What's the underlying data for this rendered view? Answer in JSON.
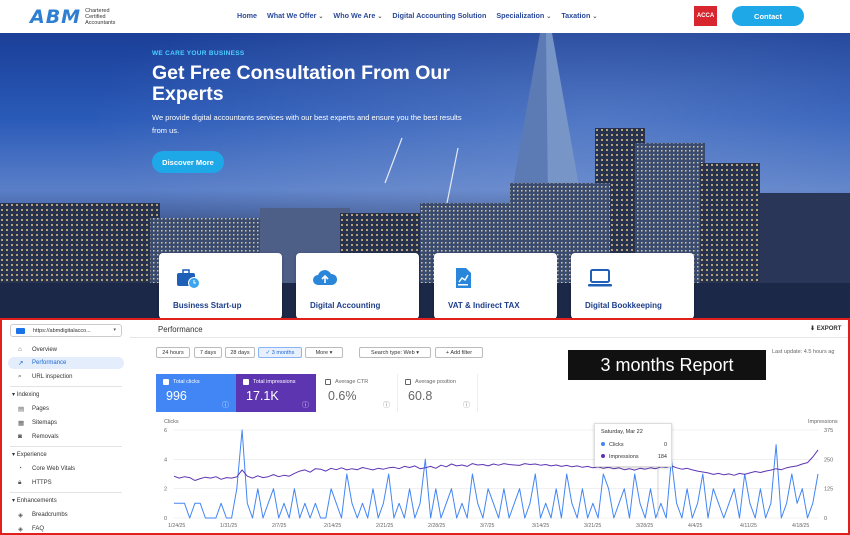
{
  "header": {
    "logo_mark": "ABM",
    "logo_sub": "Chartered Certified Accountants",
    "nav": [
      {
        "label": "Home",
        "dropdown": false
      },
      {
        "label": "What We Offer",
        "dropdown": true
      },
      {
        "label": "Who We Are",
        "dropdown": true
      },
      {
        "label": "Digital Accounting Solution",
        "dropdown": false
      },
      {
        "label": "Specialization",
        "dropdown": true
      },
      {
        "label": "Taxation",
        "dropdown": true
      }
    ],
    "acca_badge": "ACCA",
    "contact_label": "Contact"
  },
  "hero": {
    "eyebrow": "WE CARE YOUR BUSINESS",
    "title": "Get Free Consultation From Our Experts",
    "description": "We provide digital accountants services with our best experts and ensure you the best results from us.",
    "cta_label": "Discover More"
  },
  "services": [
    {
      "label": "Business Start-up",
      "icon": "briefcase-clock-icon"
    },
    {
      "label": "Digital Accounting",
      "icon": "cloud-upload-icon"
    },
    {
      "label": "VAT & Indirect TAX",
      "icon": "document-chart-icon"
    },
    {
      "label": "Digital Bookkeeping",
      "icon": "laptop-icon"
    }
  ],
  "console": {
    "property": "https://abmdigitalacco...",
    "title": "Performance",
    "export_label": "EXPORT",
    "sidebar": {
      "overview": "Overview",
      "performance": "Performance",
      "url_inspection": "URL inspection",
      "indexing": "Indexing",
      "pages": "Pages",
      "sitemaps": "Sitemaps",
      "removals": "Removals",
      "experience": "Experience",
      "core_web_vitals": "Core Web Vitals",
      "https": "HTTPS",
      "enhancements": "Enhancements",
      "breadcrumbs": "Breadcrumbs",
      "faq": "FAQ"
    },
    "filters": {
      "d24h": "24 hours",
      "d7": "7 days",
      "d28": "28 days",
      "m3": "✓  3 months",
      "more": "More ▾",
      "search_type": "Search type: Web ▾",
      "add_filter": "+  Add filter"
    },
    "last_update": "Last update: 4.5 hours ag",
    "report_label": "3 months Report",
    "metrics": {
      "clicks_label": "Total clicks",
      "clicks_value": "996",
      "impr_label": "Total impressions",
      "impr_value": "17.1K",
      "ctr_label": "Average CTR",
      "ctr_value": "0.6%",
      "pos_label": "Average position",
      "pos_value": "60.8"
    },
    "tooltip": {
      "date": "Saturday, Mar 22",
      "clicks_label": "Clicks",
      "clicks_value": "0",
      "impr_label": "Impressions",
      "impr_value": "184"
    },
    "colors": {
      "clicks": "#4285f4",
      "impressions": "#5e35b1"
    }
  },
  "chart_data": {
    "type": "line",
    "ylabel_left": "Clicks",
    "ylabel_right": "Impressions",
    "y_left_ticks": [
      "6",
      "4",
      "2",
      "0"
    ],
    "y_right_ticks": [
      "375",
      "250",
      "125",
      "0"
    ],
    "ylim_left": [
      0,
      6
    ],
    "ylim_right": [
      0,
      375
    ],
    "x_ticks": [
      "1/24/25",
      "1/31/25",
      "2/7/25",
      "2/14/25",
      "2/21/25",
      "2/28/25",
      "3/7/25",
      "3/14/25",
      "3/21/25",
      "3/28/25",
      "4/4/25",
      "4/11/25",
      "4/18/25"
    ],
    "series": [
      {
        "name": "Clicks",
        "values": [
          1,
          1,
          1,
          0,
          1,
          1,
          0,
          0,
          0,
          1,
          0,
          0,
          2,
          6,
          1,
          0,
          2,
          0,
          1,
          2,
          0,
          1,
          0,
          2,
          0,
          1,
          0,
          1,
          0,
          0,
          2,
          1,
          0,
          3,
          1,
          0,
          1,
          0,
          2,
          0,
          1,
          3,
          0,
          1,
          0,
          2,
          0,
          1,
          4,
          0,
          2,
          0,
          1,
          2,
          0,
          1,
          0,
          3,
          1,
          0,
          2,
          1,
          0,
          2,
          0,
          1,
          2,
          0,
          1,
          3,
          0,
          1,
          0,
          2,
          0,
          3,
          1,
          0,
          2,
          0,
          1,
          0,
          3,
          2,
          0,
          1,
          2,
          0,
          3,
          1,
          0,
          2,
          0,
          1,
          0,
          4,
          1,
          0,
          2,
          0,
          1,
          3,
          0,
          2,
          1,
          0,
          1,
          2,
          0,
          3,
          1,
          0,
          2,
          0,
          1,
          5,
          0,
          1,
          3,
          1,
          2,
          0,
          1,
          3
        ]
      },
      {
        "name": "Impressions",
        "values": [
          178,
          170,
          176,
          172,
          160,
          168,
          174,
          170,
          176,
          165,
          172,
          170,
          175,
          205,
          178,
          170,
          180,
          172,
          176,
          185,
          176,
          182,
          178,
          190,
          200,
          205,
          195,
          210,
          208,
          200,
          212,
          206,
          214,
          205,
          210,
          206,
          215,
          210,
          205,
          212,
          208,
          214,
          216,
          210,
          220,
          215,
          222,
          210,
          214,
          220,
          212,
          225,
          218,
          230,
          222,
          226,
          220,
          232,
          226,
          228,
          222,
          230,
          225,
          232,
          228,
          226,
          224,
          232,
          228,
          230,
          225,
          228,
          222,
          226,
          220,
          224,
          218,
          222,
          216,
          220,
          214,
          218,
          212,
          216,
          210,
          214,
          206,
          210,
          204,
          212,
          208,
          214,
          210,
          218,
          216,
          222,
          214,
          208,
          212,
          205,
          200,
          196,
          192,
          186,
          190,
          184,
          188,
          182,
          190,
          186,
          192,
          198,
          194,
          200,
          204,
          210,
          206,
          214,
          218,
          222,
          230,
          236,
          260,
          290
        ]
      }
    ]
  }
}
